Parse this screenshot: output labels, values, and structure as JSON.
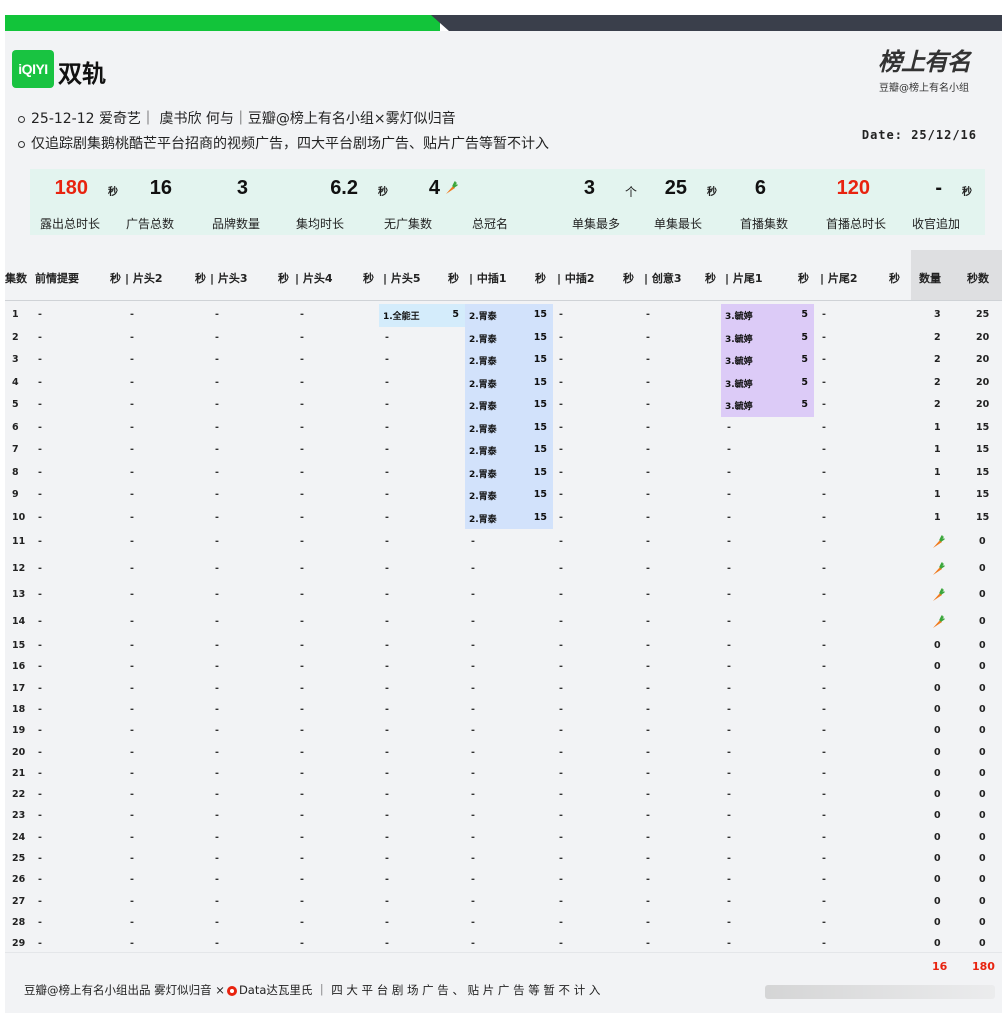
{
  "header": {
    "logo_text": "iQIYI",
    "title": "双轨",
    "brand_script": "榜上有名",
    "brand_sub": "豆瓣@榜上有名小组",
    "info_line1": "25-12-12 爱奇艺｜ 虞书欣 何与｜豆瓣@榜上有名小组×雾灯似归音",
    "info_line2": "仅追踪剧集鹅桃酷芒平台招商的视频广告，四大平台剧场广告、贴片广告等暂不计入",
    "date": "Date: 25/12/16"
  },
  "stats": [
    {
      "value": "180",
      "unit": "秒",
      "label": "露出总时长",
      "red": true
    },
    {
      "value": "16",
      "unit": "",
      "label": "广告总数"
    },
    {
      "value": "3",
      "unit": "",
      "label": "品牌数量"
    },
    {
      "value": "6.2",
      "unit": "秒",
      "label": "集均时长"
    },
    {
      "value": "4",
      "unit": "carrot",
      "label": "无广集数"
    },
    {
      "value": "",
      "unit": "",
      "label": "总冠名"
    },
    {
      "value": "3",
      "unit": "个",
      "label": "单集最多"
    },
    {
      "value": "25",
      "unit": "秒",
      "label": "单集最长"
    },
    {
      "value": "6",
      "unit": "",
      "label": "首播集数"
    },
    {
      "value": "120",
      "unit": "",
      "label": "首播总时长",
      "red": true
    },
    {
      "value": "-",
      "unit": "秒",
      "label": "收官追加"
    }
  ],
  "columns": {
    "ep": "集数",
    "slots": [
      "前情提要",
      "| 片头2",
      "| 片头3",
      "| 片头4",
      "| 片头5",
      "| 中插1",
      "| 中插2",
      "| 创意3",
      "| 片尾1",
      "| 片尾2"
    ],
    "sec": "秒",
    "count": "数量",
    "seconds": "秒数"
  },
  "ad_names": {
    "a1": "1.全能王",
    "a2": "2.胃泰",
    "a3": "3.毓婷"
  },
  "rows": [
    {
      "ep": "1",
      "slots": [
        "-",
        "-",
        "-",
        "-",
        "a1|5",
        "a2|15",
        "-",
        "-",
        "a3|5",
        "-"
      ],
      "count": "3",
      "secs": "25"
    },
    {
      "ep": "2",
      "slots": [
        "-",
        "-",
        "-",
        "-",
        "-",
        "a2|15",
        "-",
        "-",
        "a3|5",
        "-"
      ],
      "count": "2",
      "secs": "20"
    },
    {
      "ep": "3",
      "slots": [
        "-",
        "-",
        "-",
        "-",
        "-",
        "a2|15",
        "-",
        "-",
        "a3|5",
        "-"
      ],
      "count": "2",
      "secs": "20"
    },
    {
      "ep": "4",
      "slots": [
        "-",
        "-",
        "-",
        "-",
        "-",
        "a2|15",
        "-",
        "-",
        "a3|5",
        "-"
      ],
      "count": "2",
      "secs": "20"
    },
    {
      "ep": "5",
      "slots": [
        "-",
        "-",
        "-",
        "-",
        "-",
        "a2|15",
        "-",
        "-",
        "a3|5",
        "-"
      ],
      "count": "2",
      "secs": "20"
    },
    {
      "ep": "6",
      "slots": [
        "-",
        "-",
        "-",
        "-",
        "-",
        "a2|15",
        "-",
        "-",
        "-",
        "-"
      ],
      "count": "1",
      "secs": "15"
    },
    {
      "ep": "7",
      "slots": [
        "-",
        "-",
        "-",
        "-",
        "-",
        "a2|15",
        "-",
        "-",
        "-",
        "-"
      ],
      "count": "1",
      "secs": "15"
    },
    {
      "ep": "8",
      "slots": [
        "-",
        "-",
        "-",
        "-",
        "-",
        "a2|15",
        "-",
        "-",
        "-",
        "-"
      ],
      "count": "1",
      "secs": "15"
    },
    {
      "ep": "9",
      "slots": [
        "-",
        "-",
        "-",
        "-",
        "-",
        "a2|15",
        "-",
        "-",
        "-",
        "-"
      ],
      "count": "1",
      "secs": "15"
    },
    {
      "ep": "10",
      "slots": [
        "-",
        "-",
        "-",
        "-",
        "-",
        "a2|15",
        "-",
        "-",
        "-",
        "-"
      ],
      "count": "1",
      "secs": "15"
    },
    {
      "ep": "11",
      "slots": [
        "-",
        "-",
        "-",
        "-",
        "-",
        "-",
        "-",
        "-",
        "-",
        "-"
      ],
      "count": "carrot",
      "secs": "0"
    },
    {
      "ep": "12",
      "slots": [
        "-",
        "-",
        "-",
        "-",
        "-",
        "-",
        "-",
        "-",
        "-",
        "-"
      ],
      "count": "carrot",
      "secs": "0"
    },
    {
      "ep": "13",
      "slots": [
        "-",
        "-",
        "-",
        "-",
        "-",
        "-",
        "-",
        "-",
        "-",
        "-"
      ],
      "count": "carrot",
      "secs": "0"
    },
    {
      "ep": "14",
      "slots": [
        "-",
        "-",
        "-",
        "-",
        "-",
        "-",
        "-",
        "-",
        "-",
        "-"
      ],
      "count": "carrot",
      "secs": "0"
    },
    {
      "ep": "15",
      "slots": [
        "-",
        "-",
        "-",
        "-",
        "-",
        "-",
        "-",
        "-",
        "-",
        "-"
      ],
      "count": "0",
      "secs": "0"
    },
    {
      "ep": "16",
      "slots": [
        "-",
        "-",
        "-",
        "-",
        "-",
        "-",
        "-",
        "-",
        "-",
        "-"
      ],
      "count": "0",
      "secs": "0"
    },
    {
      "ep": "17",
      "slots": [
        "-",
        "-",
        "-",
        "-",
        "-",
        "-",
        "-",
        "-",
        "-",
        "-"
      ],
      "count": "0",
      "secs": "0"
    },
    {
      "ep": "18",
      "slots": [
        "-",
        "-",
        "-",
        "-",
        "-",
        "-",
        "-",
        "-",
        "-",
        "-"
      ],
      "count": "0",
      "secs": "0"
    },
    {
      "ep": "19",
      "slots": [
        "-",
        "-",
        "-",
        "-",
        "-",
        "-",
        "-",
        "-",
        "-",
        "-"
      ],
      "count": "0",
      "secs": "0"
    },
    {
      "ep": "20",
      "slots": [
        "-",
        "-",
        "-",
        "-",
        "-",
        "-",
        "-",
        "-",
        "-",
        "-"
      ],
      "count": "0",
      "secs": "0"
    },
    {
      "ep": "21",
      "slots": [
        "-",
        "-",
        "-",
        "-",
        "-",
        "-",
        "-",
        "-",
        "-",
        "-"
      ],
      "count": "0",
      "secs": "0"
    },
    {
      "ep": "22",
      "slots": [
        "-",
        "-",
        "-",
        "-",
        "-",
        "-",
        "-",
        "-",
        "-",
        "-"
      ],
      "count": "0",
      "secs": "0"
    },
    {
      "ep": "23",
      "slots": [
        "-",
        "-",
        "-",
        "-",
        "-",
        "-",
        "-",
        "-",
        "-",
        "-"
      ],
      "count": "0",
      "secs": "0"
    },
    {
      "ep": "24",
      "slots": [
        "-",
        "-",
        "-",
        "-",
        "-",
        "-",
        "-",
        "-",
        "-",
        "-"
      ],
      "count": "0",
      "secs": "0"
    },
    {
      "ep": "25",
      "slots": [
        "-",
        "-",
        "-",
        "-",
        "-",
        "-",
        "-",
        "-",
        "-",
        "-"
      ],
      "count": "0",
      "secs": "0"
    },
    {
      "ep": "26",
      "slots": [
        "-",
        "-",
        "-",
        "-",
        "-",
        "-",
        "-",
        "-",
        "-",
        "-"
      ],
      "count": "0",
      "secs": "0"
    },
    {
      "ep": "27",
      "slots": [
        "-",
        "-",
        "-",
        "-",
        "-",
        "-",
        "-",
        "-",
        "-",
        "-"
      ],
      "count": "0",
      "secs": "0"
    },
    {
      "ep": "28",
      "slots": [
        "-",
        "-",
        "-",
        "-",
        "-",
        "-",
        "-",
        "-",
        "-",
        "-"
      ],
      "count": "0",
      "secs": "0"
    },
    {
      "ep": "29",
      "slots": [
        "-",
        "-",
        "-",
        "-",
        "-",
        "-",
        "-",
        "-",
        "-",
        "-"
      ],
      "count": "0",
      "secs": "0"
    }
  ],
  "totals": {
    "count": "16",
    "secs": "180"
  },
  "footer": {
    "part1": "豆瓣@榜上有名小组出品  雾灯似归音 ×",
    "part2": "Data达瓦里氏 ｜ 四 大 平 台 剧 场 广 告 、 贴 片 广 告 等 暂 不 计 入"
  },
  "colors": {
    "green": "#12c43a",
    "red": "#e8230f",
    "ad1": "#d4ecfb",
    "ad2": "#d2e2fb",
    "ad3": "#dccbf7",
    "stats_bg": "#e3f4ef"
  }
}
